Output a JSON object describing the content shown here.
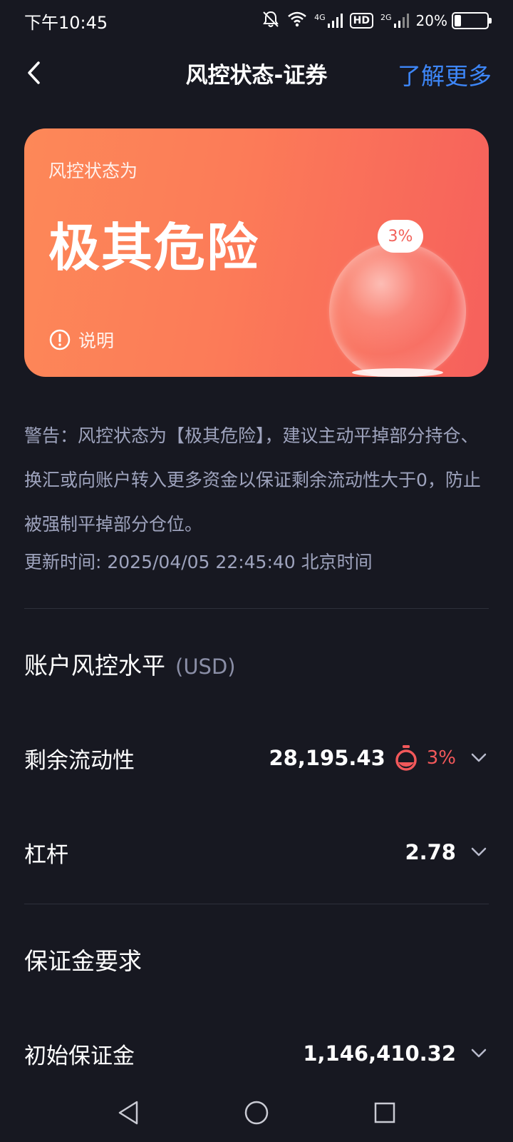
{
  "status_bar": {
    "time": "下午10:45",
    "network_4g": "4G",
    "hd_label": "HD",
    "network_2g": "2G",
    "battery_text": "20%",
    "battery_level": 0.2
  },
  "nav": {
    "back_icon": "chevron-left-icon",
    "title": "风控状态-证券",
    "more_link": "了解更多",
    "more_color": "#3d86f7"
  },
  "risk_card": {
    "label": "风控状态为",
    "status": "极其危险",
    "explain_label": "说明",
    "bubble_percent": "3%",
    "gradient_from": "#fd8858",
    "gradient_to": "#f6605c"
  },
  "warning": {
    "text": "警告：风控状态为【极其危险】，建议主动平掉部分持仓、换汇或向账户转入更多资金以保证剩余流动性大于0，防止被强制平掉部分仓位。",
    "update_time": "更新时间: 2025/04/05 22:45:40 北京时间"
  },
  "account_risk": {
    "title": "账户风控水平",
    "unit": "(USD)",
    "rows": [
      {
        "label": "剩余流动性",
        "value": "28,195.43",
        "percent": "3%",
        "icon": "timer-icon"
      },
      {
        "label": "杠杆",
        "value": "2.78"
      }
    ]
  },
  "margin": {
    "title": "保证金要求",
    "rows": [
      {
        "label": "初始保证金",
        "value": "1,146,410.32"
      }
    ]
  },
  "colors": {
    "background": "#171821",
    "danger": "#f2585a",
    "secondary_text": "#9ea3bd"
  },
  "system_nav": {
    "back": "triangle-back-icon",
    "home": "circle-home-icon",
    "recents": "square-recents-icon"
  }
}
